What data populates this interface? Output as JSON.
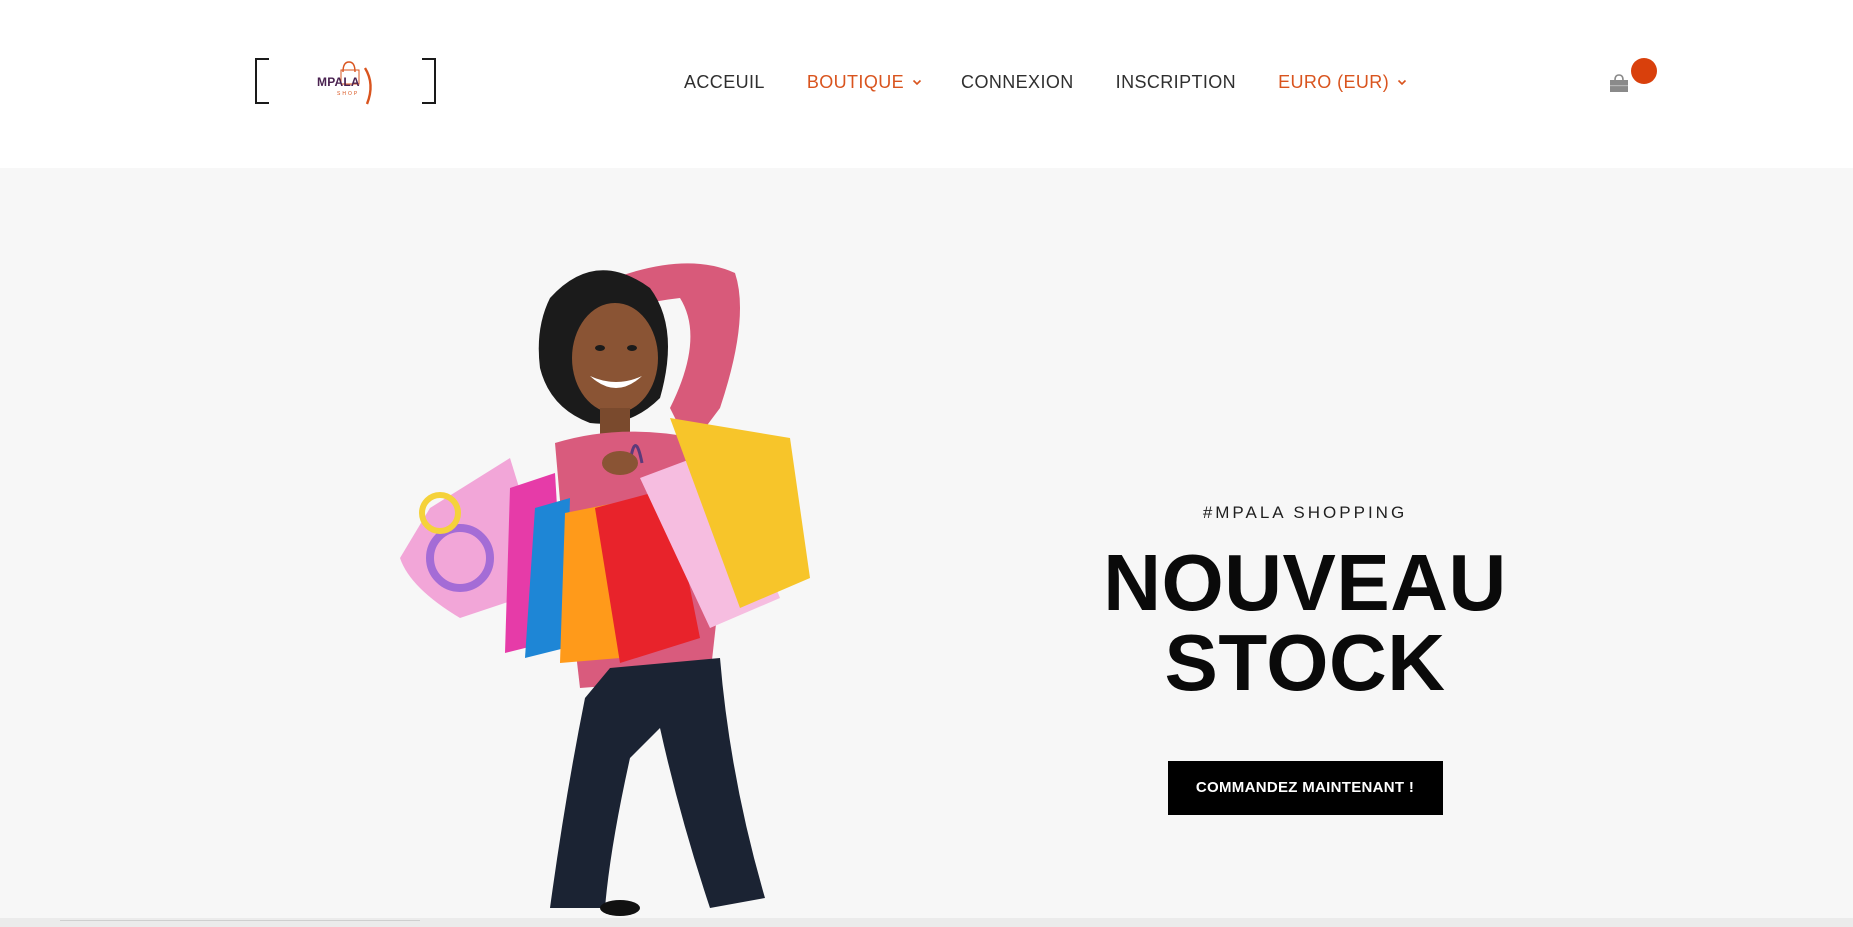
{
  "header": {
    "logo": {
      "name": "MPALA",
      "sub": "SHOP",
      "colors": {
        "primary": "#4a2351",
        "accent": "#d9541e"
      }
    },
    "nav": [
      {
        "label": "ACCEUIL",
        "active": false,
        "has_dropdown": false
      },
      {
        "label": "BOUTIQUE",
        "active": true,
        "has_dropdown": true
      },
      {
        "label": "CONNEXION",
        "active": false,
        "has_dropdown": false
      },
      {
        "label": "INSCRIPTION",
        "active": false,
        "has_dropdown": false
      },
      {
        "label": "EURO (EUR)",
        "active": true,
        "has_dropdown": true
      }
    ],
    "cart": {
      "icon": "shopping-bag-icon",
      "badge_color": "#d9400c"
    }
  },
  "hero": {
    "tag": "#MPALA SHOPPING",
    "title": "NOUVEAU STOCK",
    "cta": "COMMANDEZ MAINTENANT !",
    "image": "woman-with-shopping-bags"
  },
  "theme": {
    "accent": "#d9541e",
    "hero_bg": "#f7f7f7",
    "button_bg": "#000000"
  }
}
